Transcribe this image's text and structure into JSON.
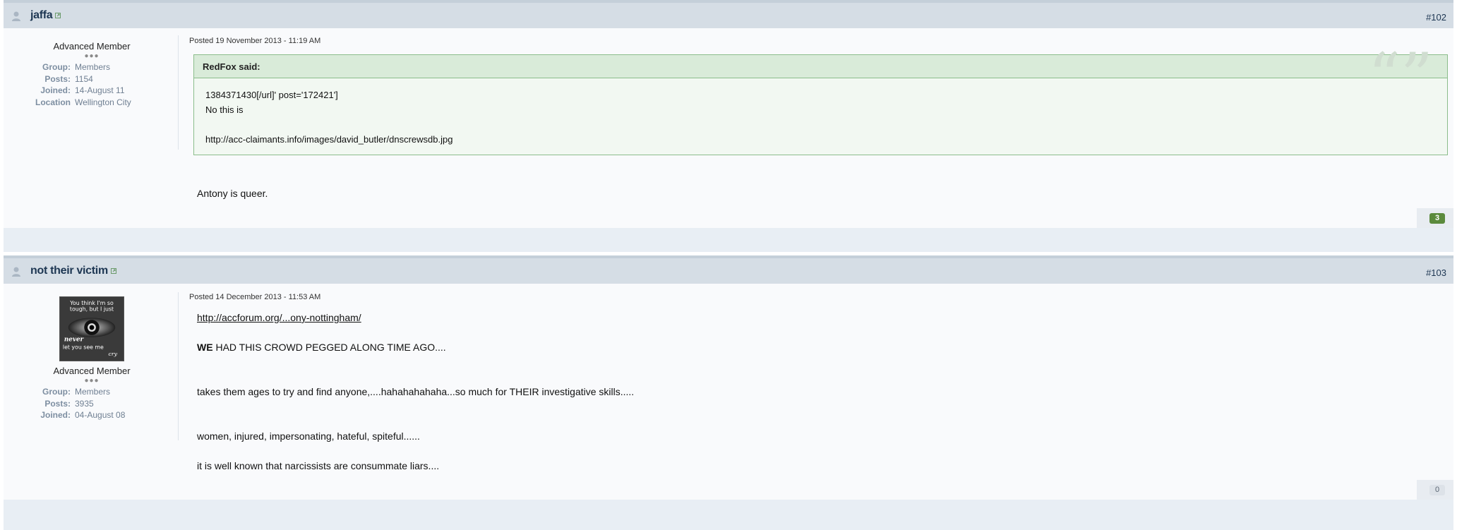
{
  "posts": [
    {
      "username": "jaffa",
      "post_number": "#102",
      "rank": "Advanced Member",
      "pips": "●●●",
      "info": [
        {
          "k": "Group:",
          "v": "Members"
        },
        {
          "k": "Posts:",
          "v": "1154"
        },
        {
          "k": "Joined:",
          "v": "14-August 11"
        },
        {
          "k": "Location",
          "v": "Wellington City"
        }
      ],
      "posted": "Posted 19 November 2013 - 11:19 AM",
      "quote": {
        "cite": "RedFox said:",
        "lines": [
          "1384371430[/url]' post='172421']",
          "No this is",
          "",
          "http://acc-claimants.info/images/david_butler/dnscrewsdb.jpg"
        ]
      },
      "body": [
        "Antony is queer."
      ],
      "reputation": "3"
    },
    {
      "username": "not their victim",
      "post_number": "#103",
      "avatar_text": [
        "You think I'm so",
        "tough, but I just",
        "never",
        "let you see  me",
        "cry"
      ],
      "rank": "Advanced Member",
      "pips": "●●●",
      "info": [
        {
          "k": "Group:",
          "v": "Members"
        },
        {
          "k": "Posts:",
          "v": "3935"
        },
        {
          "k": "Joined:",
          "v": "04-August 08"
        }
      ],
      "posted": "Posted 14 December 2013 - 11:53 AM",
      "body_link": "http://accforum.org/...ony-nottingham/",
      "body_bold": "WE",
      "body_after_bold": " HAD THIS CROWD PEGGED ALONG TIME AGO....",
      "body": [
        "takes them ages to try and find anyone,....hahahahahaha...so much for THEIR investigative skills.....",
        "women, injured, impersonating, hateful, spiteful......",
        "it is well known that narcissists are consummate liars...."
      ],
      "reputation": "0"
    }
  ]
}
